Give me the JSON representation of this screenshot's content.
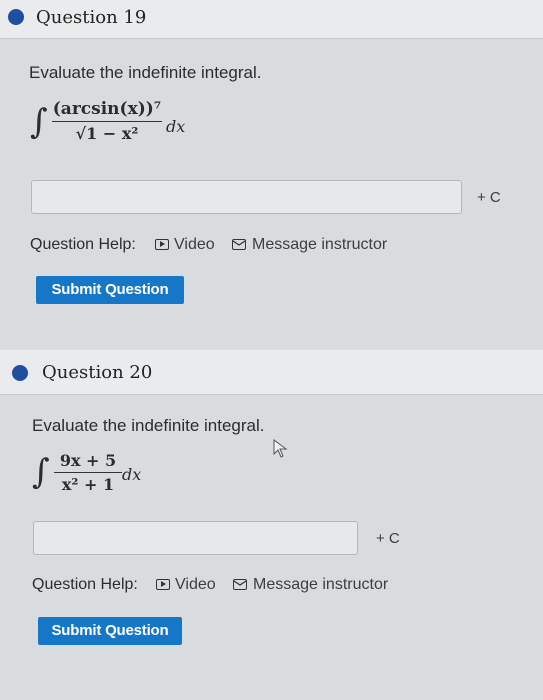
{
  "question19": {
    "title": "Question 19",
    "prompt": "Evaluate the indefinite integral.",
    "integral_sign": "∫",
    "numerator": "(arcsin(x))⁷",
    "denominator": "√1 − x²",
    "differential": "dx",
    "answer_value": "",
    "plus_c": "+ C",
    "help_label": "Question Help:",
    "video_label": "Video",
    "message_label": "Message instructor",
    "submit_label": "Submit Question"
  },
  "question20": {
    "title": "Question 20",
    "prompt": "Evaluate the indefinite integral.",
    "integral_sign": "∫",
    "numerator": "9x + 5",
    "denominator": "x² + 1",
    "differential": "dx",
    "answer_value": "",
    "plus_c": "+ C",
    "help_label": "Question Help:",
    "video_label": "Video",
    "message_label": "Message instructor",
    "submit_label": "Submit Question"
  },
  "colors": {
    "dot": "#1f4f9e",
    "submit_bg": "#1677c9"
  }
}
